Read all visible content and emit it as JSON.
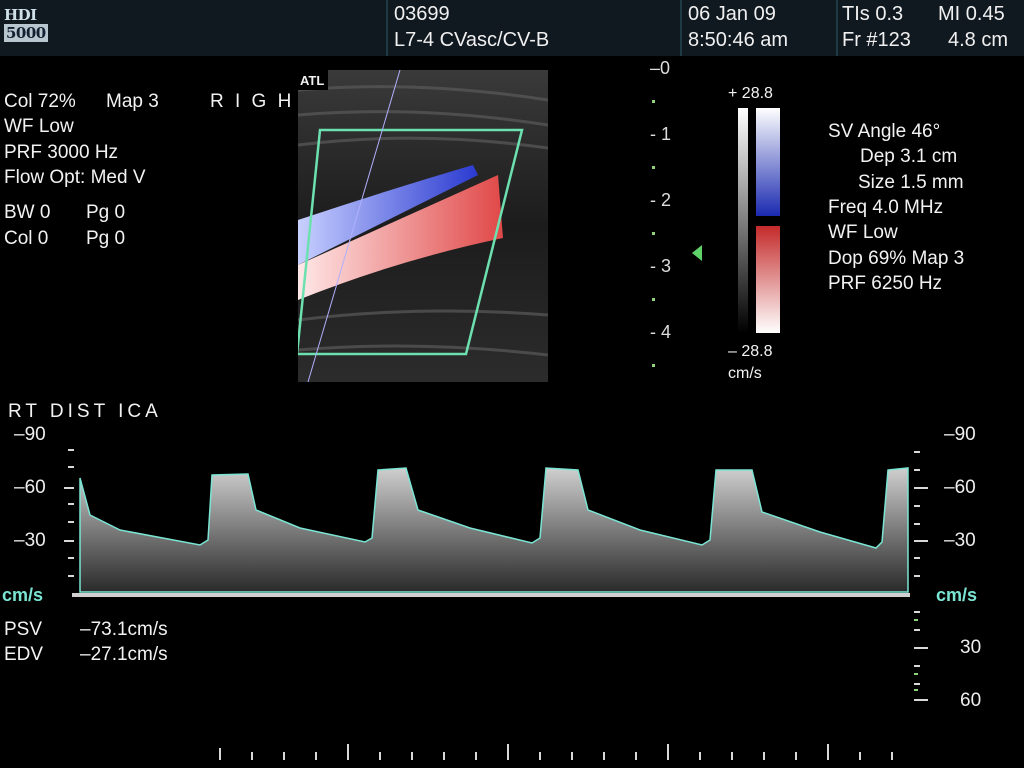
{
  "header": {
    "logo_top": "HDI",
    "logo_bottom": "5000",
    "patient_id": "03699",
    "transducer": "L7-4 CVasc/CV-B",
    "date": "06 Jan 09",
    "time": "8:50:46 am",
    "tis": "TIs 0.3",
    "mi": "MI 0.45",
    "frame": "Fr #123",
    "depth": "4.8 cm"
  },
  "left_params": {
    "col": "Col 72%",
    "map": "Map 3",
    "side": "R I G H T",
    "wf": "WF Low",
    "prf": "PRF 3000  Hz",
    "flow_opt": "Flow Opt: Med V",
    "bw": "BW 0",
    "pg1": "Pg 0",
    "col0": "Col 0",
    "pg2": "Pg 0"
  },
  "image": {
    "atl": "ATL"
  },
  "depth_scale": [
    "0",
    "1",
    "2",
    "3",
    "4"
  ],
  "color_bar": {
    "top": "+ 28.8",
    "bottom": "– 28.8",
    "unit": "cm/s",
    "colors": {
      "positive": "#1a2ab0",
      "negative": "#c42a2a"
    }
  },
  "right_params": {
    "sv_angle": "SV Angle 46°",
    "dep": "Dep 3.1  cm",
    "size": "Size 1.5  mm",
    "freq": "Freq 4.0  MHz",
    "wf": "WF Low",
    "dop": "Dop 69%  Map 3",
    "prf": "PRF 6250  Hz"
  },
  "vessel_label": "RT  DIST   ICA",
  "velocity_scale": {
    "left": [
      "–90",
      "–60",
      "–30"
    ],
    "right": [
      "–90",
      "–60",
      "–30",
      "30",
      "60"
    ],
    "unit": "cm/s"
  },
  "measurements": {
    "psv_label": "PSV",
    "psv_value": "–73.1cm/s",
    "edv_label": "EDV",
    "edv_value": "–27.1cm/s"
  }
}
